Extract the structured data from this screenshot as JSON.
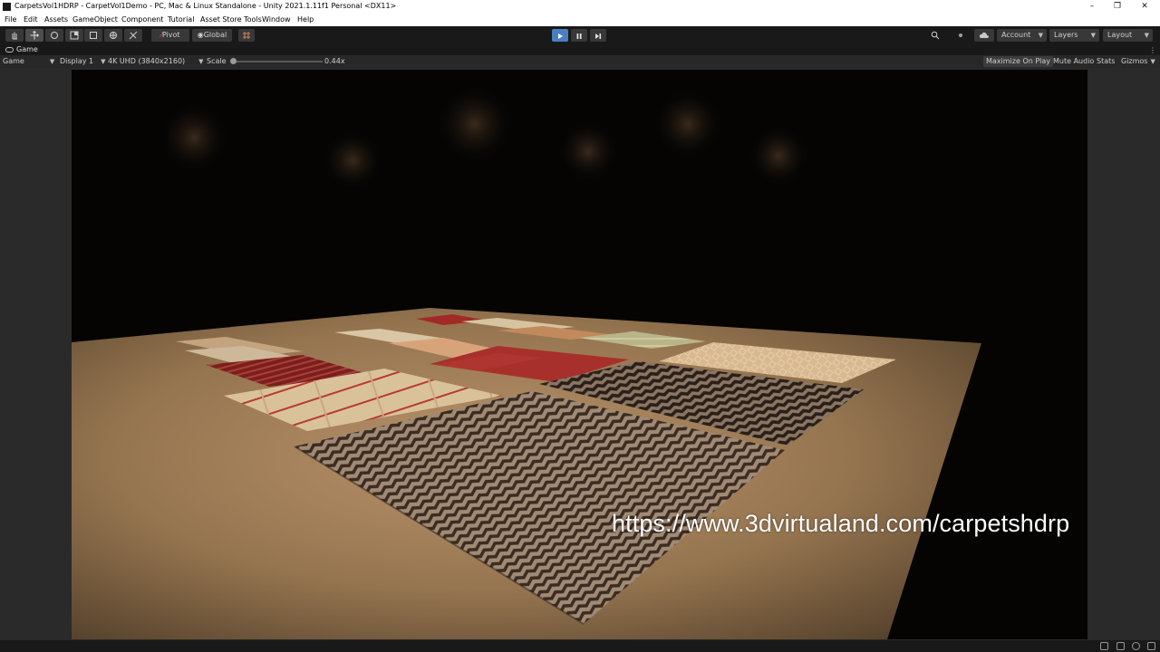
{
  "window": {
    "title": "CarpetsVol1HDRP - CarpetVol1Demo - PC, Mac & Linux Standalone - Unity 2021.1.11f1 Personal <DX11>",
    "controls": [
      "minimize-icon",
      "restore-icon",
      "close-icon"
    ]
  },
  "menu": {
    "items": [
      "File",
      "Edit",
      "Assets",
      "GameObject",
      "Component",
      "Tutorial",
      "Asset Store Tools",
      "Window",
      "Help"
    ]
  },
  "toolbar": {
    "tools": [
      "hand-tool-icon",
      "move-tool-icon",
      "rotate-tool-icon",
      "scale-tool-icon",
      "rect-tool-icon",
      "transform-tool-icon",
      "custom-tool-icon"
    ],
    "pivot_label": "Pivot",
    "global_label": "Global",
    "playback": [
      "play-icon",
      "pause-icon",
      "step-icon"
    ],
    "account_label": "Account",
    "layers_label": "Layers",
    "layout_label": "Layout"
  },
  "tab": {
    "label": "Game"
  },
  "gamebar": {
    "game_dropdown": "Game",
    "display": "Display 1",
    "resolution": "4K UHD (3840x2160)",
    "scale_label": "Scale",
    "scale_value": "0.44x",
    "maximize": "Maximize On Play",
    "mute": "Mute Audio",
    "stats": "Stats",
    "gizmos": "Gizmos"
  },
  "scene": {
    "watermark": "https://www.3dvirtualand.com/carpetshdrp"
  },
  "colors": {
    "accent_play": "#4a7fc1",
    "editor_bg": "#191919",
    "floor": "#9a7b5c"
  }
}
